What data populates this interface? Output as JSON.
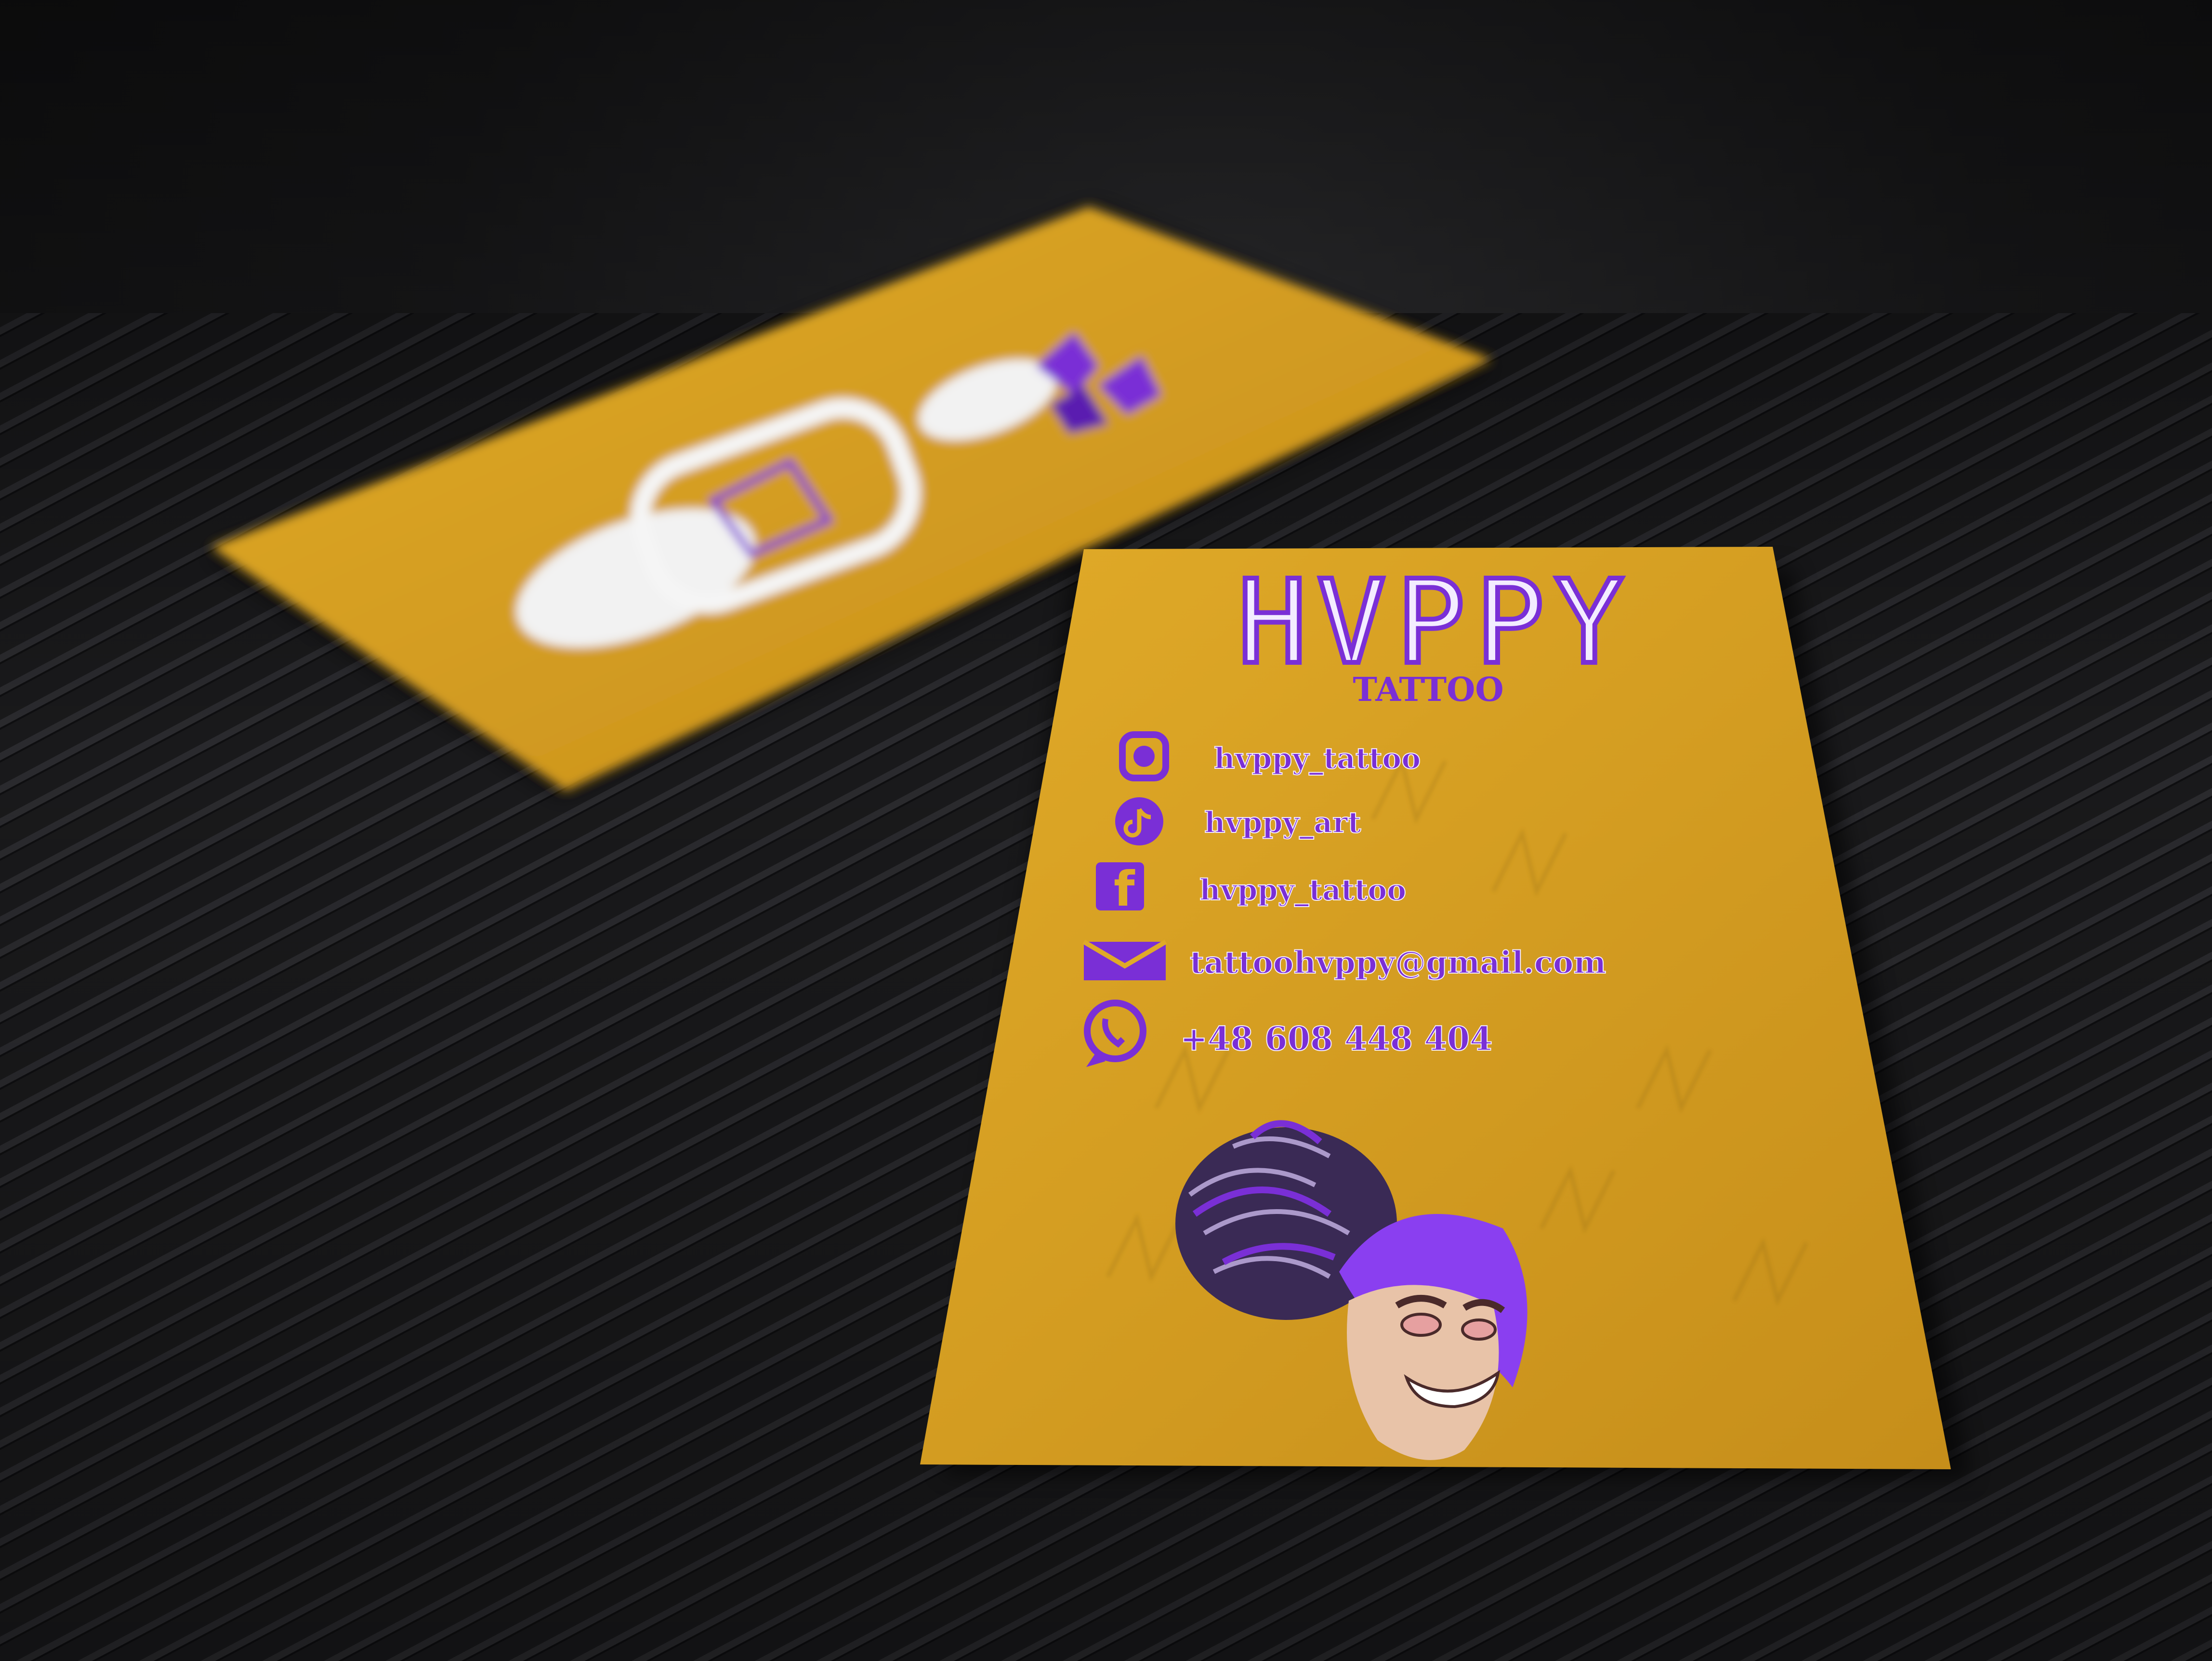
{
  "card": {
    "logo_text": "HVPPY",
    "subtitle": "TATTOO",
    "contacts": [
      {
        "icon": "instagram-icon",
        "text": "hvppy_tattoo"
      },
      {
        "icon": "tiktok-icon",
        "text": "hvppy_art"
      },
      {
        "icon": "facebook-icon",
        "text": "hvppy_tattoo"
      },
      {
        "icon": "mail-icon",
        "text": "tattoohvppy@gmail.com"
      },
      {
        "icon": "whatsapp-icon",
        "text": "+48 608 448 404"
      }
    ]
  },
  "colors": {
    "card_yellow": "#d9a21f",
    "card_yellow_dark": "#b9861a",
    "accent_purple": "#7a2fd6",
    "background": "#1c1c1e"
  }
}
